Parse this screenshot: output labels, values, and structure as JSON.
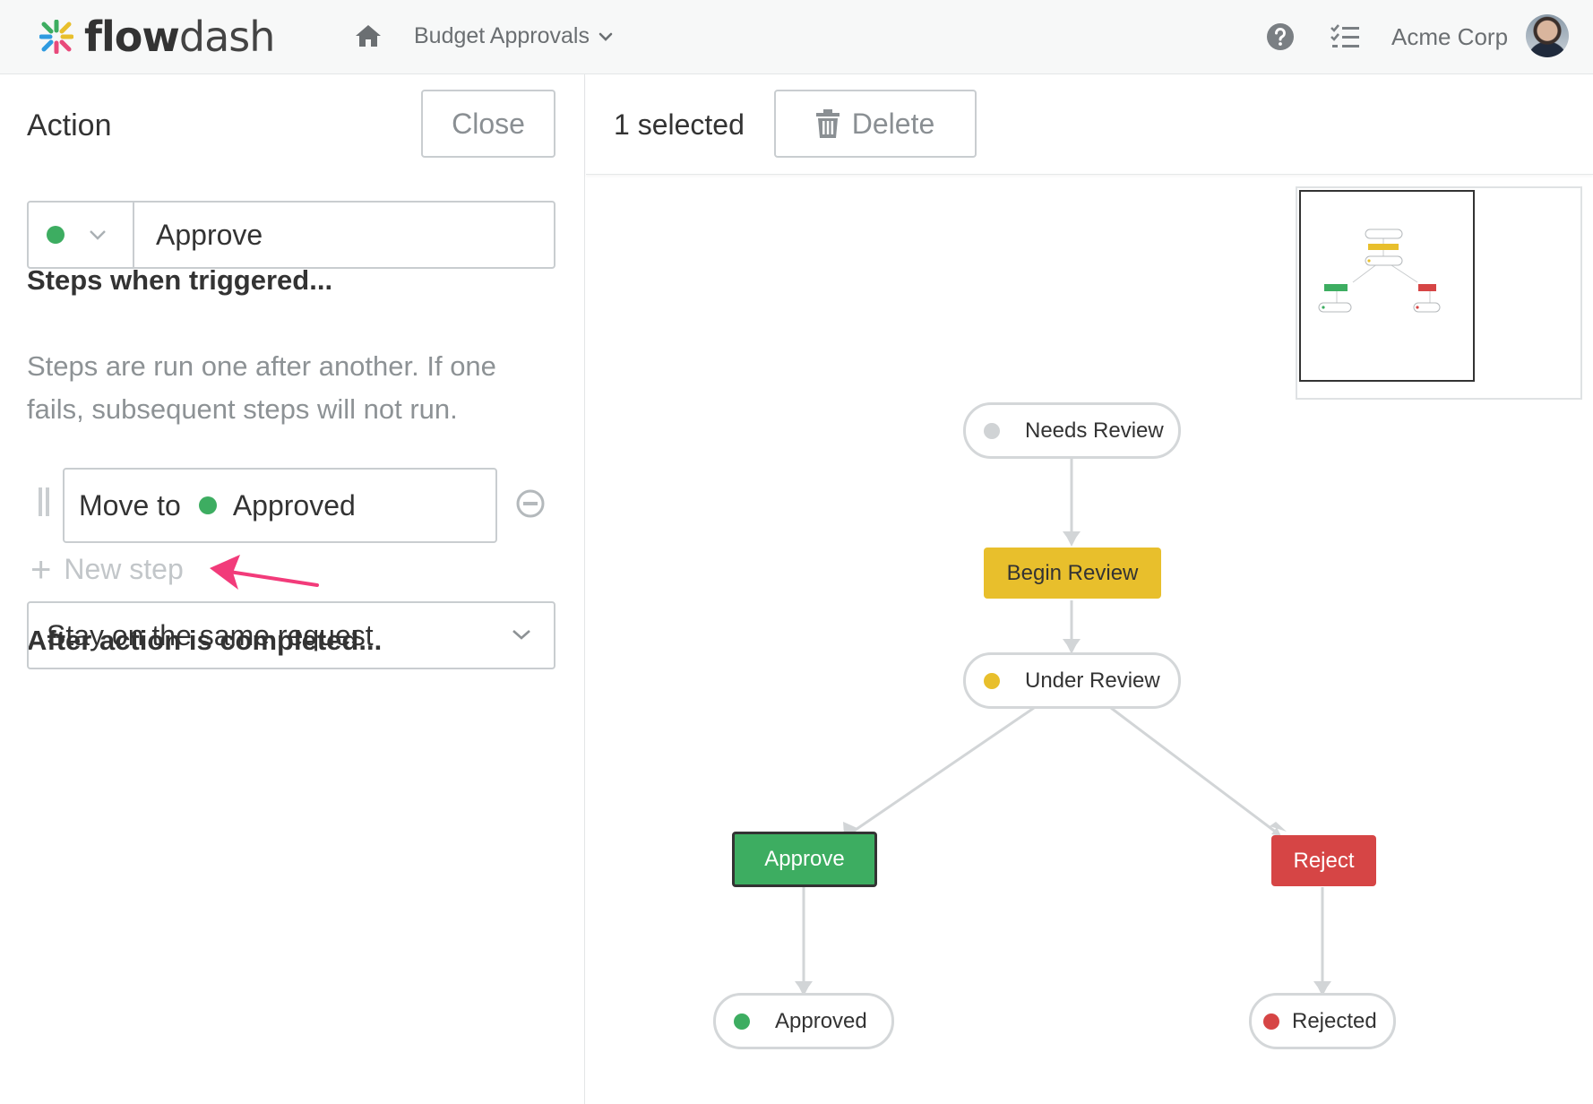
{
  "header": {
    "logo_bold": "flow",
    "logo_light": "dash",
    "breadcrumb": "Budget Approvals",
    "org_name": "Acme Corp",
    "icons": [
      "home-icon",
      "help-icon",
      "tasks-icon",
      "chevron-down-icon",
      "avatar"
    ]
  },
  "action_panel": {
    "title": "Action",
    "close_label": "Close",
    "action_name": "Approve",
    "action_color": "#3dad61",
    "steps_heading": "Steps when triggered...",
    "steps_help": "Steps are run one after another. If one fails, subsequent steps will not run.",
    "steps": [
      {
        "prefix": "Move to",
        "target": "Approved",
        "target_color": "#3dad61"
      }
    ],
    "new_step_label": "New step",
    "after_heading": "After action is completed...",
    "after_value": "Stay on the same request"
  },
  "toolbar": {
    "selected_label": "1 selected",
    "delete_label": "Delete"
  },
  "workflow": {
    "nodes": {
      "needs_review": {
        "label": "Needs Review",
        "kind": "state",
        "color": "#d0d3d5"
      },
      "begin_review": {
        "label": "Begin Review",
        "kind": "action",
        "color": "#e8bf2c"
      },
      "under_review": {
        "label": "Under Review",
        "kind": "state",
        "color": "#e8bf2c"
      },
      "approve": {
        "label": "Approve",
        "kind": "action",
        "color": "#3dad61",
        "selected": true
      },
      "reject": {
        "label": "Reject",
        "kind": "action",
        "color": "#d64545"
      },
      "approved": {
        "label": "Approved",
        "kind": "state",
        "color": "#3dad61"
      },
      "rejected": {
        "label": "Rejected",
        "kind": "state",
        "color": "#d64545"
      }
    }
  },
  "colors": {
    "accent_green": "#3dad61",
    "accent_yellow": "#e8bf2c",
    "accent_red": "#d64545",
    "annotation_pink": "#f23b7a"
  }
}
